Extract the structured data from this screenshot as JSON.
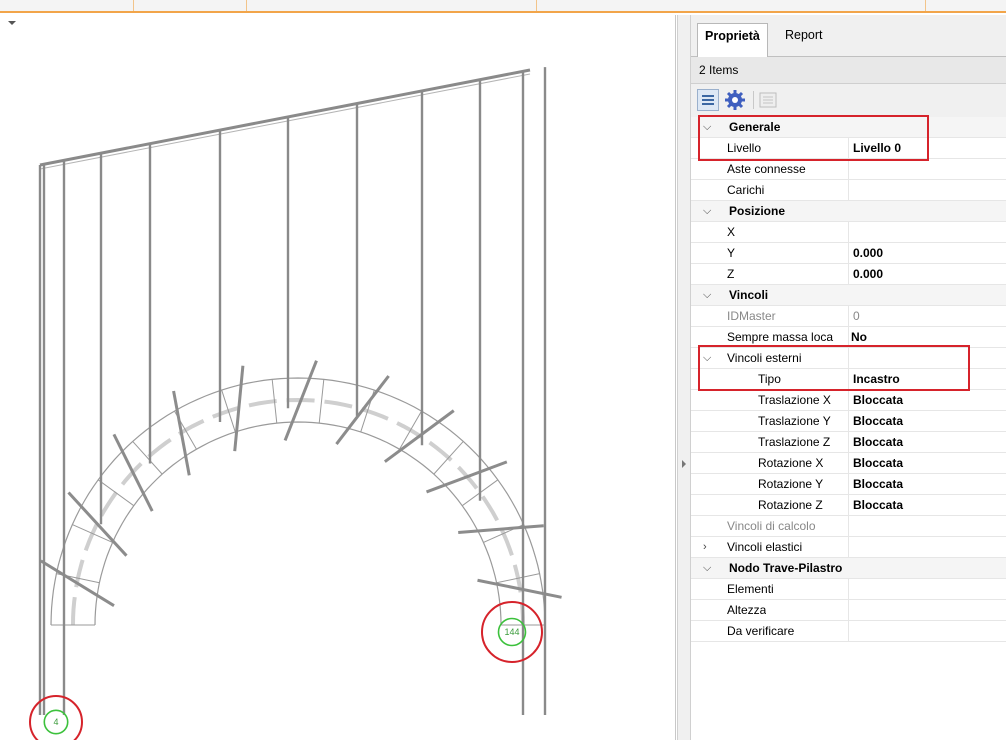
{
  "tabs": {
    "properties": "Proprietà",
    "report": "Report"
  },
  "items_count": "2 Items",
  "toolbar": {
    "icons": [
      "grid-list-icon",
      "gear-icon",
      "disabled-list-icon"
    ]
  },
  "nodes": {
    "left": "4",
    "right": "144"
  },
  "properties": {
    "generale": {
      "title": "Generale",
      "livello": {
        "name": "Livello",
        "value": "Livello 0"
      },
      "aste": {
        "name": "Aste connesse",
        "value": ""
      },
      "carichi": {
        "name": "Carichi",
        "value": ""
      }
    },
    "posizione": {
      "title": "Posizione",
      "x": {
        "name": "X",
        "value": ""
      },
      "y": {
        "name": "Y",
        "value": "0.000"
      },
      "z": {
        "name": "Z",
        "value": "0.000"
      }
    },
    "vincoli": {
      "title": "Vincoli",
      "idmaster": {
        "name": "IDMaster",
        "value": "0"
      },
      "sempre": {
        "name": "Sempre massa loca",
        "value": "No"
      },
      "esterni": {
        "title": "Vincoli esterni",
        "tipo": {
          "name": "Tipo",
          "value": "Incastro"
        },
        "tx": {
          "name": "Traslazione X",
          "value": "Bloccata"
        },
        "ty": {
          "name": "Traslazione Y",
          "value": "Bloccata"
        },
        "tz": {
          "name": "Traslazione Z",
          "value": "Bloccata"
        },
        "rx": {
          "name": "Rotazione X",
          "value": "Bloccata"
        },
        "ry": {
          "name": "Rotazione Y",
          "value": "Bloccata"
        },
        "rz": {
          "name": "Rotazione Z",
          "value": "Bloccata"
        }
      },
      "calcolo": {
        "name": "Vincoli di calcolo",
        "value": ""
      },
      "elastici": {
        "name": "Vincoli elastici",
        "value": ""
      }
    },
    "nodo": {
      "title": "Nodo Trave-Pilastro",
      "elementi": {
        "name": "Elementi",
        "value": ""
      },
      "altezza": {
        "name": "Altezza",
        "value": ""
      },
      "verificare": {
        "name": "Da verificare",
        "value": ""
      }
    }
  },
  "colors": {
    "highlight": "#d6232b",
    "node": "#3cc13c",
    "accent": "#f2a54a"
  }
}
